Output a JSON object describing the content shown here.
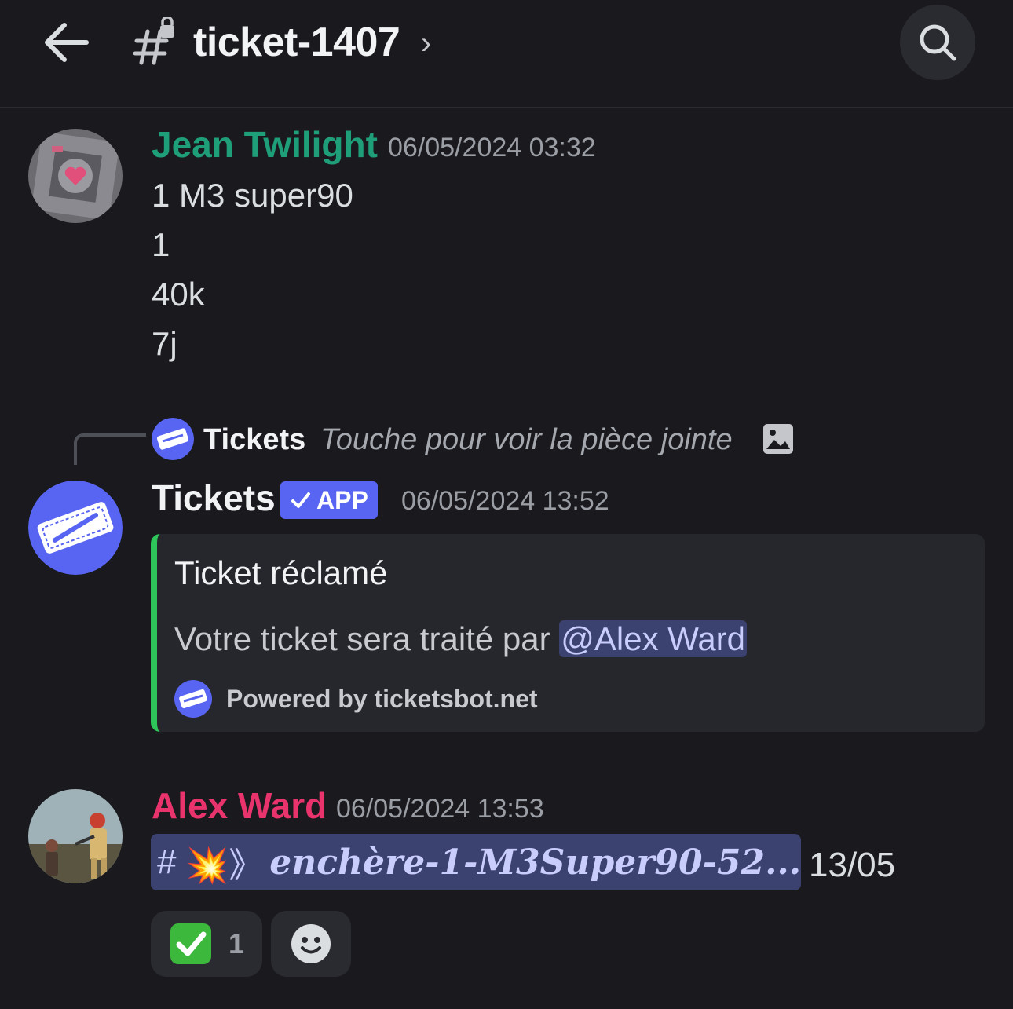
{
  "header": {
    "channel_name": "ticket-1407",
    "chevron": "›"
  },
  "messages": [
    {
      "author": "Jean Twilight",
      "author_color": "#1f9e7a",
      "timestamp": "06/05/2024 03:32",
      "lines": [
        "1 M3 super90",
        "1",
        "40k",
        "7j"
      ]
    },
    {
      "reply": {
        "author": "Tickets",
        "text": "Touche pour voir la pièce jointe",
        "icon": "image-icon"
      },
      "author": "Tickets",
      "badge": "APP",
      "timestamp": "06/05/2024 13:52",
      "embed": {
        "accent_color": "#2ec65a",
        "title": "Ticket réclamé",
        "description": "Votre ticket sera traité par",
        "mention": "@Alex Ward",
        "footer": "Powered by ticketsbot.net"
      }
    },
    {
      "author": "Alex Ward",
      "author_color": "#e8336d",
      "timestamp": "06/05/2024 13:53",
      "channel_link": {
        "hash": "#",
        "emoji": "💥》",
        "name": "enchère-1-M3Super90-52..."
      },
      "after_text": "13/05",
      "reactions": [
        {
          "emoji": "✅",
          "count": "1"
        }
      ]
    }
  ]
}
